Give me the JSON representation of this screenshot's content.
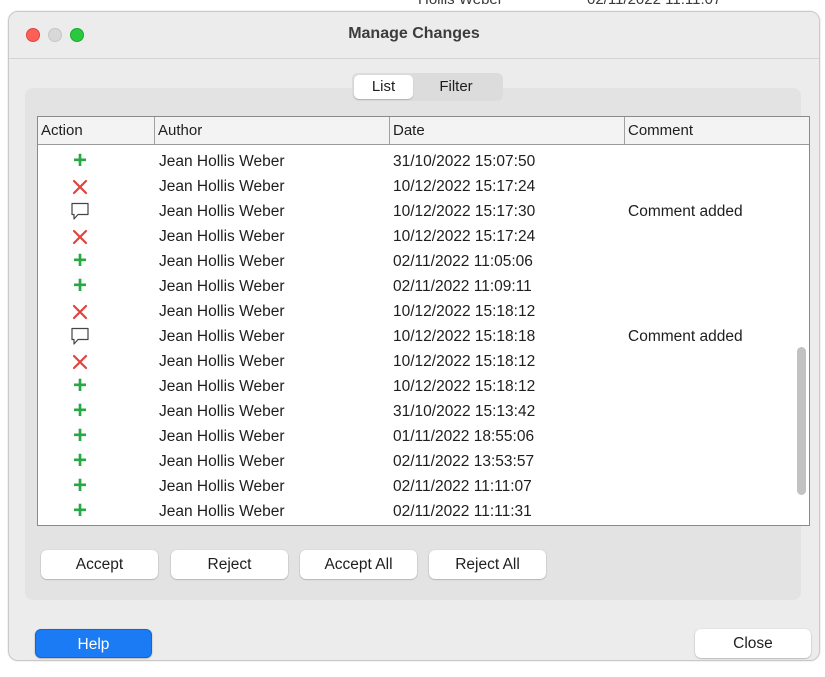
{
  "background_window": {
    "partial_author": "Hollis Weber",
    "partial_date": "02/11/2022 11:11:07"
  },
  "window": {
    "title": "Manage Changes"
  },
  "tabs": {
    "list_label": "List",
    "filter_label": "Filter",
    "selected": "List"
  },
  "table": {
    "columns": {
      "action": "Action",
      "author": "Author",
      "date": "Date",
      "comment": "Comment"
    },
    "rows": [
      {
        "action_icon": "insertion-plus-icon",
        "author": "Jean Hollis Weber",
        "date": "31/10/2022 15:07:50",
        "comment": ""
      },
      {
        "action_icon": "deletion-x-icon",
        "author": "Jean Hollis Weber",
        "date": "10/12/2022 15:17:24",
        "comment": ""
      },
      {
        "action_icon": "comment-bubble-icon",
        "author": "Jean Hollis Weber",
        "date": "10/12/2022 15:17:30",
        "comment": "Comment added"
      },
      {
        "action_icon": "deletion-x-icon",
        "author": "Jean Hollis Weber",
        "date": "10/12/2022 15:17:24",
        "comment": ""
      },
      {
        "action_icon": "insertion-plus-icon",
        "author": "Jean Hollis Weber",
        "date": "02/11/2022 11:05:06",
        "comment": ""
      },
      {
        "action_icon": "insertion-plus-icon",
        "author": "Jean Hollis Weber",
        "date": "02/11/2022 11:09:11",
        "comment": ""
      },
      {
        "action_icon": "deletion-x-icon",
        "author": "Jean Hollis Weber",
        "date": "10/12/2022 15:18:12",
        "comment": ""
      },
      {
        "action_icon": "comment-bubble-icon",
        "author": "Jean Hollis Weber",
        "date": "10/12/2022 15:18:18",
        "comment": "Comment added"
      },
      {
        "action_icon": "deletion-x-icon",
        "author": "Jean Hollis Weber",
        "date": "10/12/2022 15:18:12",
        "comment": ""
      },
      {
        "action_icon": "insertion-plus-icon",
        "author": "Jean Hollis Weber",
        "date": "10/12/2022 15:18:12",
        "comment": ""
      },
      {
        "action_icon": "insertion-plus-icon",
        "author": "Jean Hollis Weber",
        "date": "31/10/2022 15:13:42",
        "comment": ""
      },
      {
        "action_icon": "insertion-plus-icon",
        "author": "Jean Hollis Weber",
        "date": "01/11/2022 18:55:06",
        "comment": ""
      },
      {
        "action_icon": "insertion-plus-icon",
        "author": "Jean Hollis Weber",
        "date": "02/11/2022 13:53:57",
        "comment": ""
      },
      {
        "action_icon": "insertion-plus-icon",
        "author": "Jean Hollis Weber",
        "date": "02/11/2022 11:11:07",
        "comment": ""
      },
      {
        "action_icon": "insertion-plus-icon",
        "author": "Jean Hollis Weber",
        "date": "02/11/2022 11:11:31",
        "comment": ""
      }
    ]
  },
  "actions": {
    "accept_label": "Accept",
    "reject_label": "Reject",
    "accept_all_label": "Accept All",
    "reject_all_label": "Reject All"
  },
  "footer": {
    "help_label": "Help",
    "close_label": "Close"
  },
  "colors": {
    "insertion": "#27a746",
    "deletion": "#e0443e",
    "help_button": "#1b7bf5"
  }
}
